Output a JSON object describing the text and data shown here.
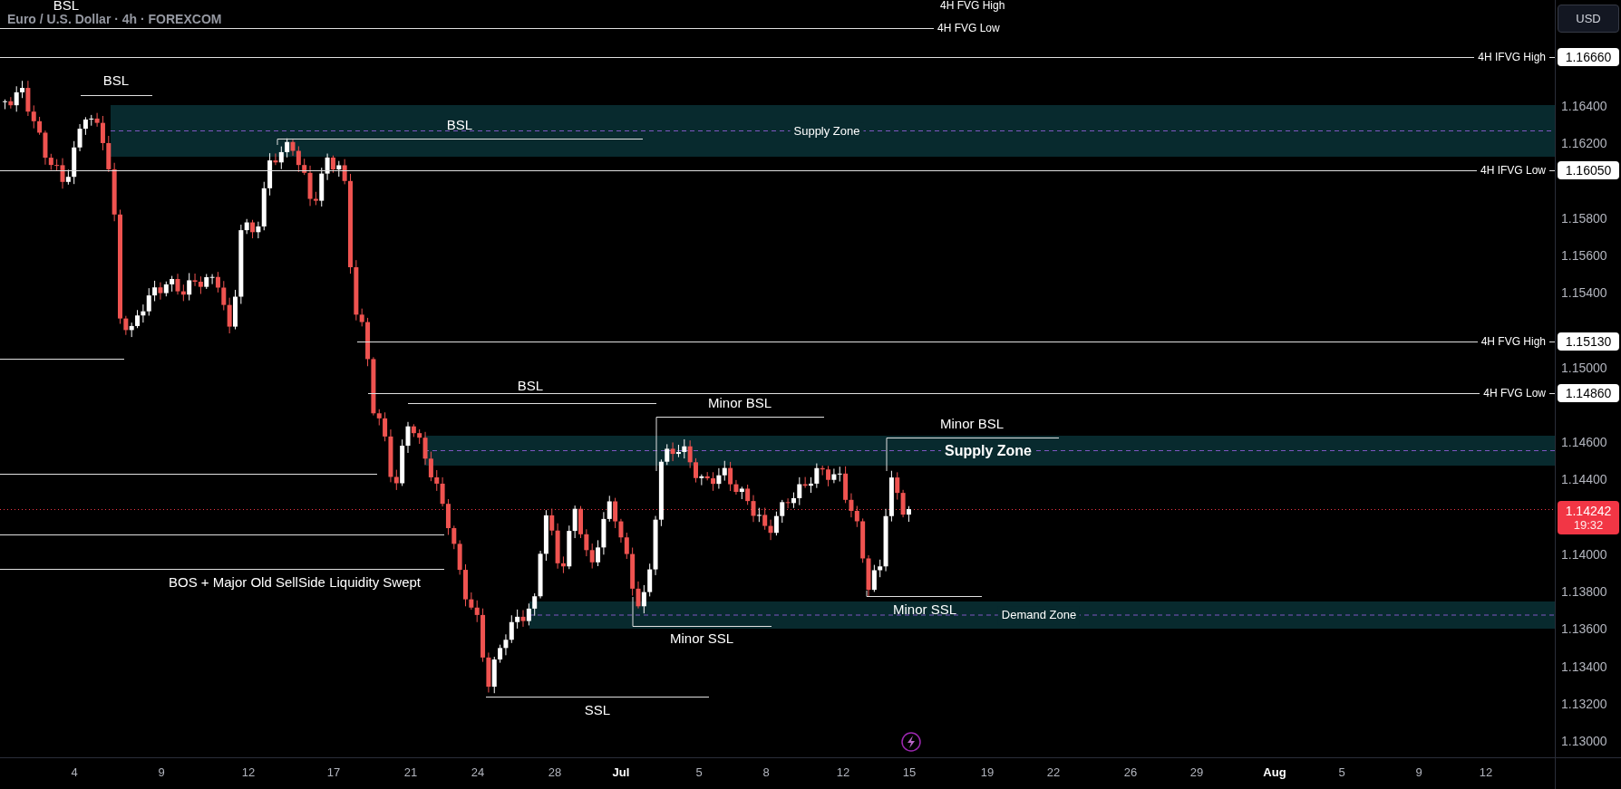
{
  "chart_title": "Euro / U.S. Dollar · 4h · FOREXCOM",
  "currency_button": "USD",
  "levels": [
    {
      "label": "4H FVG High"
    },
    {
      "label": "4H FVG Low"
    },
    {
      "label": "4H IFVG High",
      "price": "1.16660"
    },
    {
      "label": "4H IFVG Low",
      "price": "1.16050"
    },
    {
      "label": "4H FVG High",
      "price": "1.15130"
    },
    {
      "label": "4H FVG Low",
      "price": "1.14860"
    }
  ],
  "zones": [
    {
      "label": "Supply Zone"
    },
    {
      "label": "Supply Zone"
    },
    {
      "label": "Demand Zone"
    }
  ],
  "liquidity_marks": [
    {
      "label": "BSL"
    },
    {
      "label": "BSL"
    },
    {
      "label": "BSL"
    },
    {
      "label": "BSL"
    },
    {
      "label": "Minor BSL"
    },
    {
      "label": "Minor BSL"
    },
    {
      "label": "BOS + Major Old SellSide Liquidity Swept"
    },
    {
      "label": "Minor SSL"
    },
    {
      "label": "Minor SSL"
    },
    {
      "label": "SSL"
    }
  ],
  "price_axis": {
    "ticks": [
      "1.16400",
      "1.16200",
      "1.15800",
      "1.15600",
      "1.15400",
      "1.15000",
      "1.14600",
      "1.14400",
      "1.14000",
      "1.13800",
      "1.13600",
      "1.13400",
      "1.13200",
      "1.13000"
    ],
    "current_price": "1.14242",
    "countdown": "19:32"
  },
  "time_axis": [
    {
      "label": "4",
      "month": false
    },
    {
      "label": "9",
      "month": false
    },
    {
      "label": "12",
      "month": false
    },
    {
      "label": "17",
      "month": false
    },
    {
      "label": "21",
      "month": false
    },
    {
      "label": "24",
      "month": false
    },
    {
      "label": "28",
      "month": false
    },
    {
      "label": "Jul",
      "month": true
    },
    {
      "label": "5",
      "month": false
    },
    {
      "label": "8",
      "month": false
    },
    {
      "label": "12",
      "month": false
    },
    {
      "label": "15",
      "month": false
    },
    {
      "label": "19",
      "month": false
    },
    {
      "label": "22",
      "month": false
    },
    {
      "label": "26",
      "month": false
    },
    {
      "label": "29",
      "month": false
    },
    {
      "label": "Aug",
      "month": true
    },
    {
      "label": "5",
      "month": false
    },
    {
      "label": "9",
      "month": false
    },
    {
      "label": "12",
      "month": false
    }
  ]
}
